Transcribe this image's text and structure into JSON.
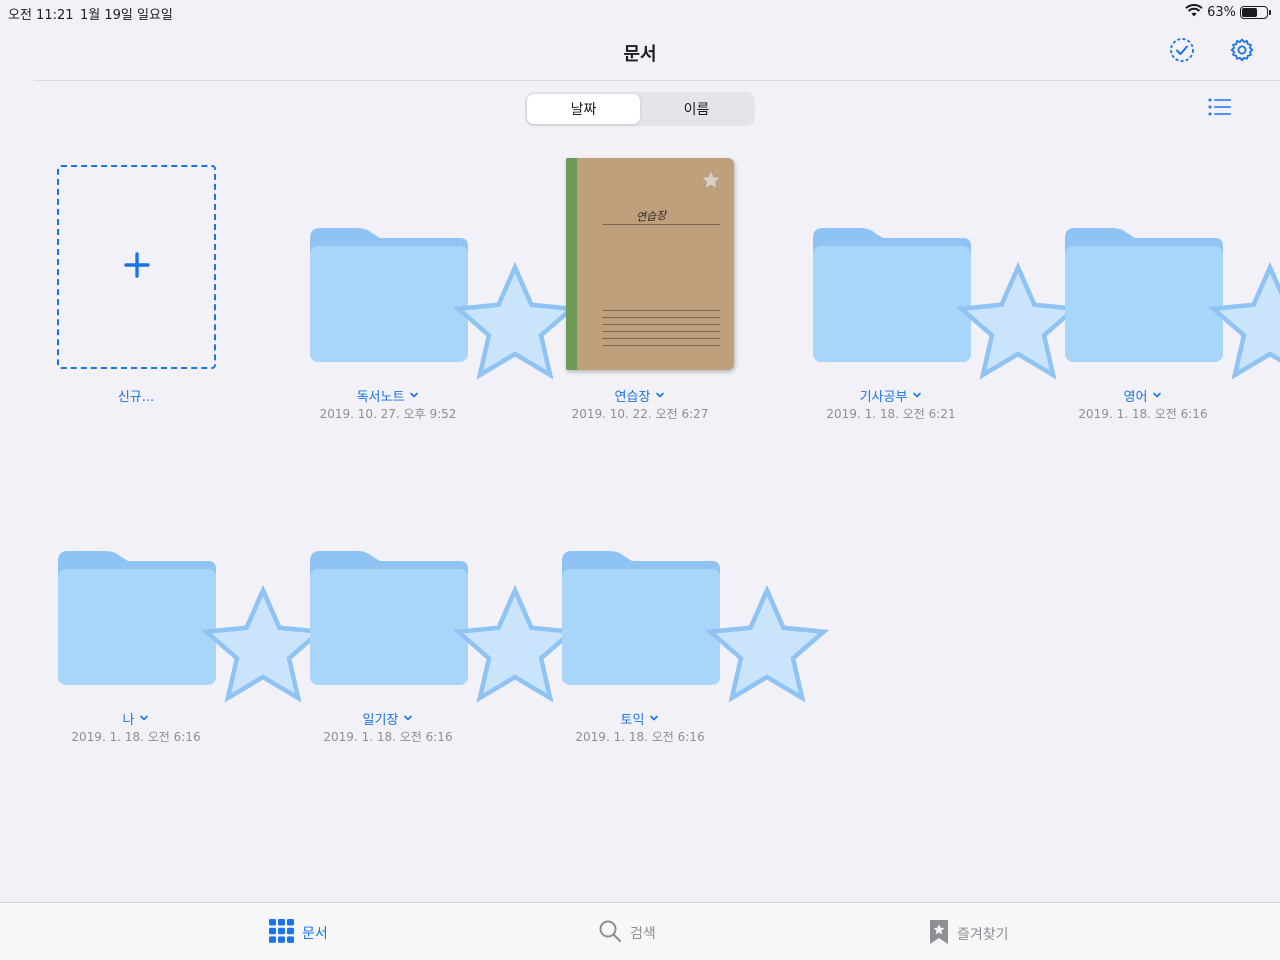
{
  "status_bar": {
    "time": "오전 11:21",
    "date": "1월 19일 일요일",
    "battery": "63%",
    "battery_level": 0.63
  },
  "nav": {
    "title": "문서",
    "select_icon": "checkmark-circle-dashed-icon",
    "settings_icon": "gear-icon"
  },
  "sort": {
    "options": [
      "날짜",
      "이름"
    ],
    "selected": "날짜"
  },
  "view_toggle_icon": "list-icon",
  "new_item": {
    "label": "신규..."
  },
  "items": [
    {
      "type": "folder",
      "name": "독서노트",
      "date": "2019. 10. 27. 오후 9:52"
    },
    {
      "type": "notebook",
      "name": "연습장",
      "date": "2019. 10. 22. 오전 6:27",
      "cover_text": "연습장"
    },
    {
      "type": "folder",
      "name": "기사공부",
      "date": "2019. 1. 18. 오전 6:21"
    },
    {
      "type": "folder",
      "name": "영어",
      "date": "2019. 1. 18. 오전 6:16"
    },
    {
      "type": "folder",
      "name": "나",
      "date": "2019. 1. 18. 오전 6:16"
    },
    {
      "type": "folder",
      "name": "일기장",
      "date": "2019. 1. 18. 오전 6:16"
    },
    {
      "type": "folder",
      "name": "토익",
      "date": "2019. 1. 18. 오전 6:16"
    }
  ],
  "tabs": [
    {
      "label": "문서",
      "icon": "grid-icon",
      "active": true
    },
    {
      "label": "검색",
      "icon": "search-icon",
      "active": false
    },
    {
      "label": "즐겨찾기",
      "icon": "bookmark-star-icon",
      "active": false
    }
  ],
  "colors": {
    "accent": "#1a73e8",
    "folder_front": "#a8d6fb",
    "folder_back": "#8fc3f4",
    "background": "#f2f1f7"
  }
}
